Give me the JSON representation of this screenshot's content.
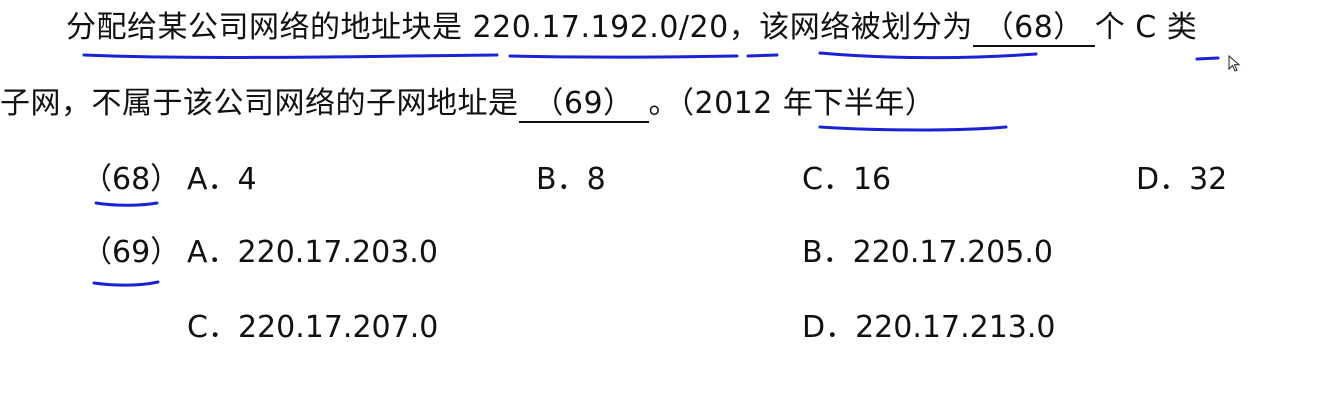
{
  "question": {
    "line1": {
      "text_before": "分配给某公司网络的地址块是 220.17.192.0/20，该网络被划分为",
      "blank": "（68）",
      "text_after": "个 C 类"
    },
    "line2": {
      "text_before": "子网，不属于该公司网络的子网地址是",
      "blank": "（69）",
      "text_after": "。（2012 年下半年）"
    }
  },
  "q68": {
    "label": "（68）",
    "options": [
      "A．4",
      "B．8",
      "C．16",
      "D．32"
    ]
  },
  "q69": {
    "label": "（69）",
    "options": [
      "A．220.17.203.0",
      "B．220.17.205.0",
      "C．220.17.207.0",
      "D．220.17.213.0"
    ]
  },
  "colors": {
    "text": "#111111",
    "annotation": "#1a22d6",
    "background": "#ffffff"
  }
}
